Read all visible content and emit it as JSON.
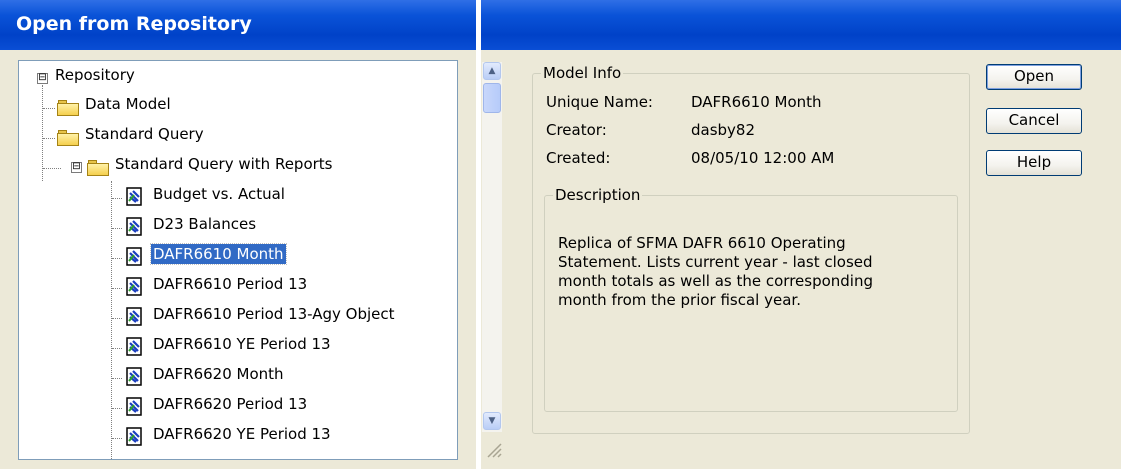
{
  "window": {
    "title": "Open from Repository"
  },
  "tree": {
    "root": "Repository",
    "folders": [
      "Data Model",
      "Standard Query",
      "Standard Query with Reports"
    ],
    "reports": [
      "Budget vs. Actual",
      "D23 Balances",
      "DAFR6610 Month",
      "DAFR6610 Period 13",
      "DAFR6610 Period 13-Agy Object",
      "DAFR6610 YE Period 13",
      "DAFR6620 Month",
      "DAFR6620 Period 13",
      "DAFR6620 YE Period 13"
    ],
    "selected": "DAFR6610 Month"
  },
  "model_info": {
    "legend": "Model Info",
    "unique_name_label": "Unique Name:",
    "unique_name": "DAFR6610 Month",
    "creator_label": "Creator:",
    "creator": "dasby82",
    "created_label": "Created:",
    "created": "08/05/10 12:00 AM"
  },
  "description": {
    "legend": "Description",
    "text": "Replica of SFMA DAFR 6610 Operating Statement. Lists current year - last closed month totals as well as the corresponding month from the prior fiscal year."
  },
  "buttons": {
    "open": "Open",
    "cancel": "Cancel",
    "help": "Help"
  },
  "icons": {
    "expander_open": "⊟",
    "folder": "folder-icon",
    "report": "report-icon",
    "scroll_up": "▲",
    "scroll_down": "▼"
  }
}
